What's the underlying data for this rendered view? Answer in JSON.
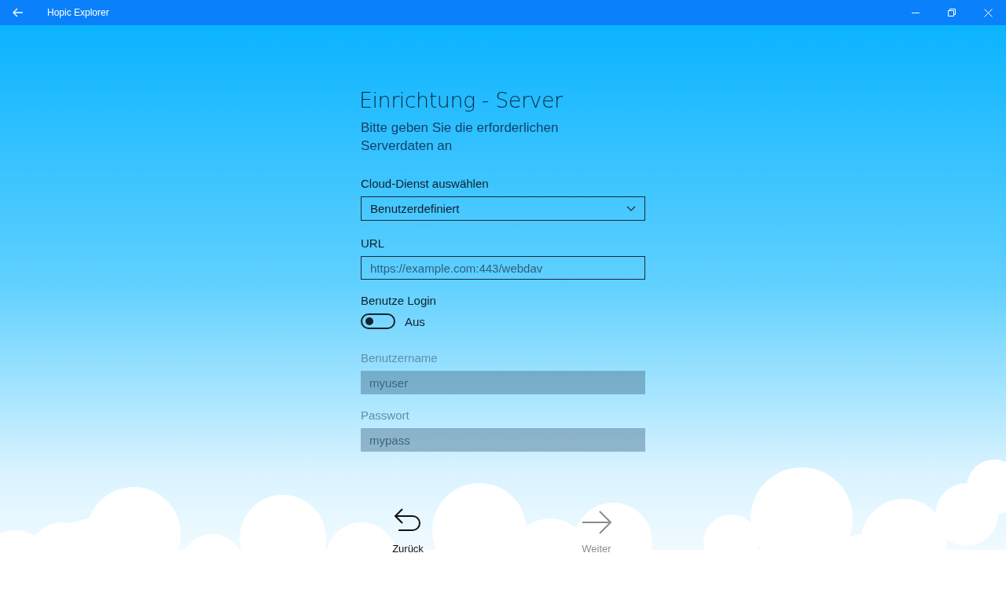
{
  "window": {
    "title": "Hopic Explorer"
  },
  "heading": "Einrichtung - Server",
  "subtitle": "Bitte geben Sie die erforderlichen Serverdaten an",
  "fields": [
    {
      "kind": "dropdown",
      "label": "Cloud-Dienst auswählen",
      "value": "Benutzerdefiniert",
      "disabled": false
    },
    {
      "kind": "text",
      "label": "URL",
      "placeholder": "https://example.com:443/webdav",
      "disabled": false
    },
    {
      "kind": "toggle",
      "label": "Benutze Login",
      "on": false,
      "state_text": "Aus"
    },
    {
      "kind": "text",
      "label": "Benutzername",
      "placeholder": "myuser",
      "disabled": true
    },
    {
      "kind": "text",
      "label": "Passwort",
      "placeholder": "mypass",
      "disabled": true
    }
  ],
  "buttons": [
    {
      "kind": "back",
      "label": "Zurück",
      "disabled": false
    },
    {
      "kind": "next",
      "label": "Weiter",
      "disabled": true
    }
  ]
}
